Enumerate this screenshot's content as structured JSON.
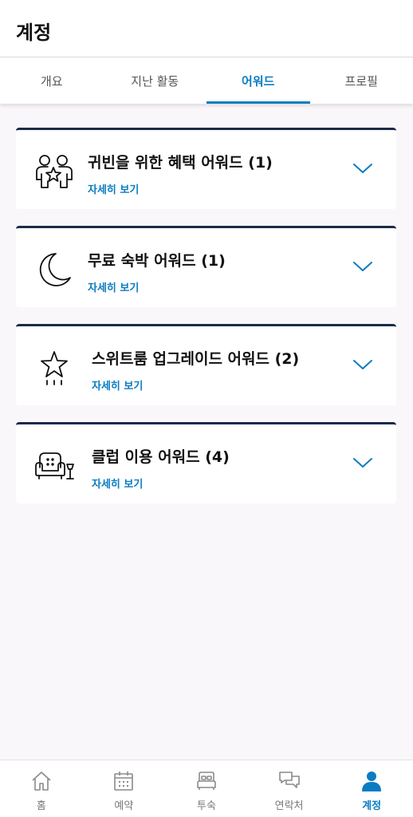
{
  "header": {
    "title": "계정"
  },
  "tabs": [
    {
      "label": "개요"
    },
    {
      "label": "지난 활동"
    },
    {
      "label": "어워드",
      "active": true
    },
    {
      "label": "프로필"
    }
  ],
  "awards": [
    {
      "title": "귀빈을 위한 혜택 어워드 (1)",
      "link": "자세히 보기",
      "icon": "people-star-icon"
    },
    {
      "title": "무료 숙박 어워드 (1)",
      "link": "자세히 보기",
      "icon": "moon-icon"
    },
    {
      "title": "스위트룸 업그레이드 어워드 (2)",
      "link": "자세히 보기",
      "icon": "star-icon"
    },
    {
      "title": "클럽 이용 어워드 (4)",
      "link": "자세히 보기",
      "icon": "armchair-lamp-icon"
    }
  ],
  "bottom_nav": [
    {
      "label": "홈",
      "icon": "home-icon"
    },
    {
      "label": "예약",
      "icon": "calendar-icon"
    },
    {
      "label": "투숙",
      "icon": "bed-icon"
    },
    {
      "label": "연락처",
      "icon": "chat-bubbles-icon"
    },
    {
      "label": "계정",
      "icon": "person-icon",
      "active": true
    }
  ],
  "colors": {
    "accent": "#0a7cc1",
    "card_border": "#1b2a4a",
    "background": "#faf7fb"
  }
}
